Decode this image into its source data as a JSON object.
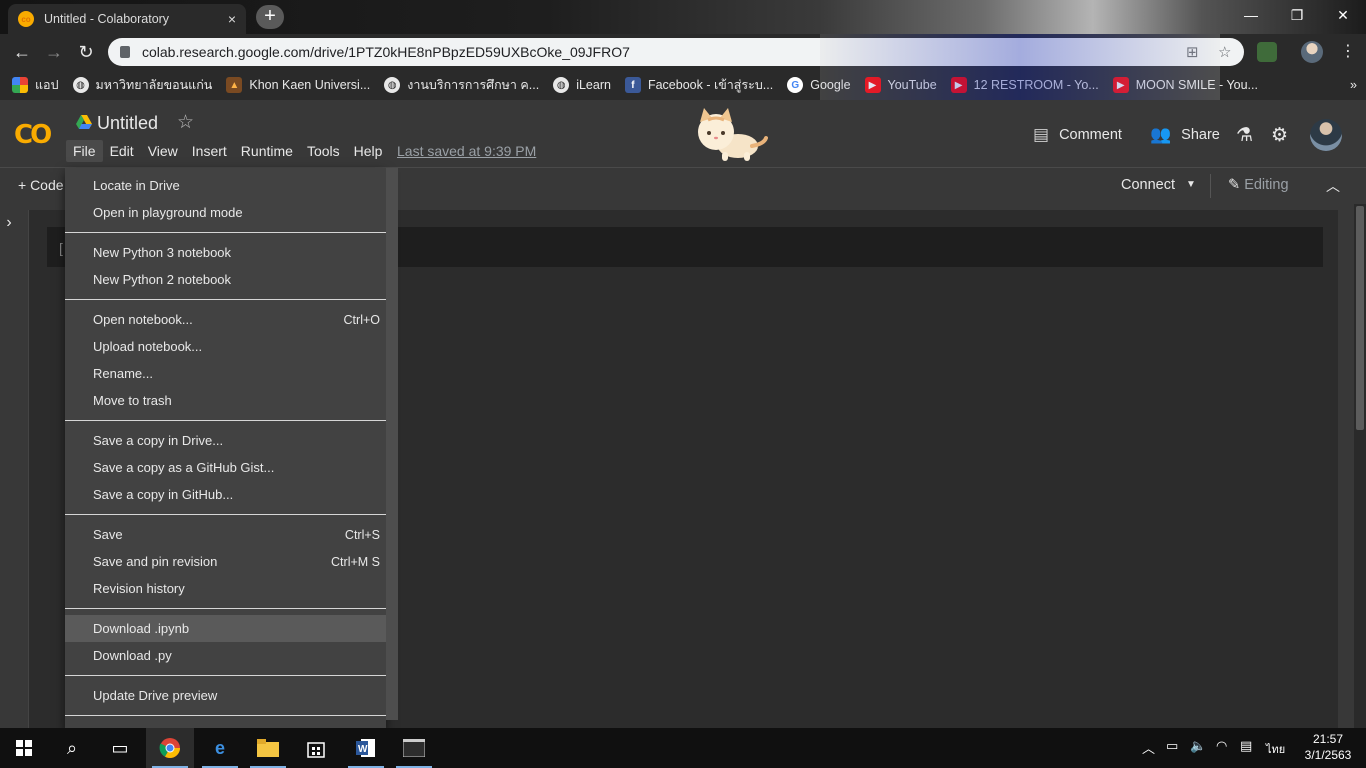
{
  "browser": {
    "tab_title": "Untitled - Colaboratory",
    "tab_close": "×",
    "new_tab": "+",
    "window_controls": {
      "minimize": "—",
      "restore": "❐",
      "close": "✕"
    },
    "url": "colab.research.google.com/drive/1PTZ0kHE8nPBpzED59UXBcOke_09JFRO7",
    "nav": {
      "back": "←",
      "forward": "→",
      "reload": "↻"
    },
    "bookmarks": [
      {
        "label": "แอป",
        "icon": "apps-grid-icon"
      },
      {
        "label": "มหาวิทยาลัยขอนแก่น",
        "icon": "globe-icon"
      },
      {
        "label": "Khon Kaen Universi...",
        "icon": "flame-icon"
      },
      {
        "label": "งานบริการการศึกษา ค...",
        "icon": "globe-icon"
      },
      {
        "label": "iLearn",
        "icon": "globe-icon"
      },
      {
        "label": "Facebook - เข้าสู่ระบ...",
        "icon": "facebook-icon"
      },
      {
        "label": "Google",
        "icon": "google-icon"
      },
      {
        "label": "YouTube",
        "icon": "youtube-icon"
      },
      {
        "label": "12 RESTROOM - Yo...",
        "icon": "youtube-icon"
      },
      {
        "label": "MOON SMILE - You...",
        "icon": "youtube-icon"
      }
    ],
    "more_bookmarks": "»"
  },
  "colab": {
    "logo": "CO",
    "title": "Untitled",
    "star": "☆",
    "menus": [
      "File",
      "Edit",
      "View",
      "Insert",
      "Runtime",
      "Tools",
      "Help"
    ],
    "last_saved": "Last saved at 9:39 PM",
    "comment_label": "Comment",
    "share_label": "Share",
    "add_code": "+ Code",
    "connect_label": "Connect",
    "editing_label": "Editing",
    "cell_bracket": "["
  },
  "file_menu": {
    "groups": [
      [
        {
          "label": "Locate in Drive",
          "shortcut": ""
        },
        {
          "label": "Open in playground mode",
          "shortcut": ""
        }
      ],
      [
        {
          "label": "New Python 3 notebook",
          "shortcut": ""
        },
        {
          "label": "New Python 2 notebook",
          "shortcut": ""
        }
      ],
      [
        {
          "label": "Open notebook...",
          "shortcut": "Ctrl+O"
        },
        {
          "label": "Upload notebook...",
          "shortcut": ""
        },
        {
          "label": "Rename...",
          "shortcut": ""
        },
        {
          "label": "Move to trash",
          "shortcut": ""
        }
      ],
      [
        {
          "label": "Save a copy in Drive...",
          "shortcut": ""
        },
        {
          "label": "Save a copy as a GitHub Gist...",
          "shortcut": ""
        },
        {
          "label": "Save a copy in GitHub...",
          "shortcut": ""
        }
      ],
      [
        {
          "label": "Save",
          "shortcut": "Ctrl+S"
        },
        {
          "label": "Save and pin revision",
          "shortcut": "Ctrl+M S"
        },
        {
          "label": "Revision history",
          "shortcut": ""
        }
      ],
      [
        {
          "label": "Download .ipynb",
          "shortcut": "",
          "hover": true
        },
        {
          "label": "Download .py",
          "shortcut": ""
        }
      ],
      [
        {
          "label": "Update Drive preview",
          "shortcut": ""
        }
      ]
    ]
  },
  "taskbar": {
    "time": "21:57",
    "date": "3/1/2563",
    "language": "ไทย"
  },
  "colors": {
    "accent": "#f9ab00",
    "menu_bg": "#424242",
    "page_bg": "#383838"
  }
}
